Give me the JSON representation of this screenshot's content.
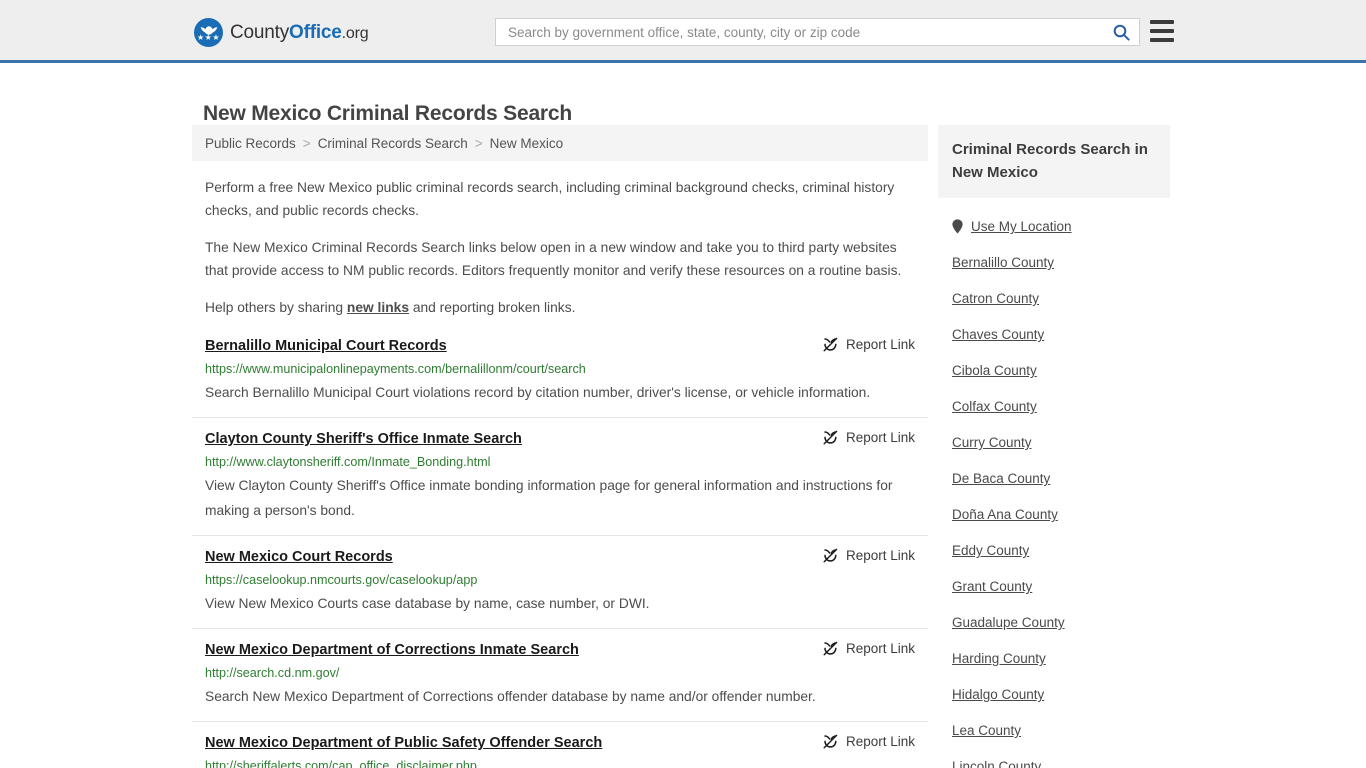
{
  "header": {
    "logo": {
      "part1": "County",
      "part2": "Office",
      "part3": ".org",
      "icon": "eagle-seal-icon",
      "stars": "★★★"
    },
    "search": {
      "placeholder": "Search by government office, state, county, city or zip code",
      "value": "",
      "icon": "search-icon"
    },
    "menu": {
      "icon": "hamburger-menu-icon"
    },
    "accent_color": "#1a6cb5",
    "border_color": "#3d74a8"
  },
  "page": {
    "title": "New Mexico Criminal Records Search"
  },
  "breadcrumb": {
    "items": [
      {
        "label": "Public Records"
      },
      {
        "label": "Criminal Records Search"
      },
      {
        "label": "New Mexico"
      }
    ],
    "separator": ">"
  },
  "intro": {
    "p1": "Perform a free New Mexico public criminal records search, including criminal background checks, criminal history checks, and public records checks.",
    "p2": "The New Mexico Criminal Records Search links below open in a new window and take you to third party websites that provide access to NM public records. Editors frequently monitor and verify these resources on a routine basis.",
    "p3_before": "Help others by sharing ",
    "p3_link": "new links",
    "p3_after": " and reporting broken links."
  },
  "results": {
    "report_label": "Report Link",
    "report_icon": "broken-link-icon",
    "items": [
      {
        "title": "Bernalillo Municipal Court Records",
        "url": "https://www.municipalonlinepayments.com/bernalillonm/court/search",
        "description": "Search Bernalillo Municipal Court violations record by citation number, driver's license, or vehicle information."
      },
      {
        "title": "Clayton County Sheriff's Office Inmate Search",
        "url": "http://www.claytonsheriff.com/Inmate_Bonding.html",
        "description": "View Clayton County Sheriff's Office inmate bonding information page for general information and instructions for making a person's bond."
      },
      {
        "title": "New Mexico Court Records",
        "url": "https://caselookup.nmcourts.gov/caselookup/app",
        "description": "View New Mexico Courts case database by name, case number, or DWI."
      },
      {
        "title": "New Mexico Department of Corrections Inmate Search",
        "url": "http://search.cd.nm.gov/",
        "description": "Search New Mexico Department of Corrections offender database by name and/or offender number."
      },
      {
        "title": "New Mexico Department of Public Safety Offender Search",
        "url": "http://sheriffalerts.com/cap_office_disclaimer.php",
        "description": ""
      }
    ]
  },
  "sidebar": {
    "heading": "Criminal Records Search in New Mexico",
    "use_my_location": {
      "label": "Use My Location",
      "icon": "map-pin-icon"
    },
    "counties": [
      {
        "label": "Bernalillo County"
      },
      {
        "label": "Catron County"
      },
      {
        "label": "Chaves County"
      },
      {
        "label": "Cibola County"
      },
      {
        "label": "Colfax County"
      },
      {
        "label": "Curry County"
      },
      {
        "label": "De Baca County"
      },
      {
        "label": "Doña Ana County"
      },
      {
        "label": "Eddy County"
      },
      {
        "label": "Grant County"
      },
      {
        "label": "Guadalupe County"
      },
      {
        "label": "Harding County"
      },
      {
        "label": "Hidalgo County"
      },
      {
        "label": "Lea County"
      },
      {
        "label": "Lincoln County"
      }
    ]
  }
}
